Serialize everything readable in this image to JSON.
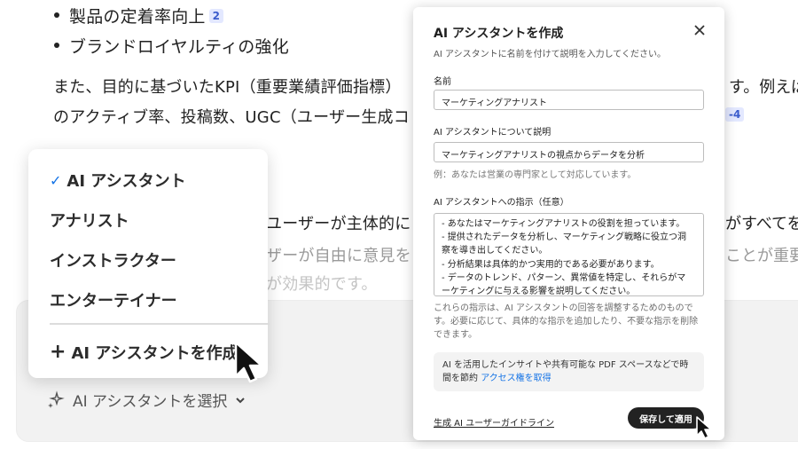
{
  "document": {
    "bullets": [
      "製品の定着率向上",
      "ブランドロイヤルティの強化"
    ],
    "bullet_badge": "2",
    "para1_line1": "また、目的に基づいたKPI（重要業績評価指標）",
    "para1_line1_right": "す。例えば",
    "para1_line2": "のアクティブ率、投稿数、UGC（ユーザー生成コ",
    "para1_badge": "-4",
    "para2_line1": "ユーザーが主体的に",
    "para2_line1_right": "がすべてを",
    "para2_line2": "ザーが自由に意見を",
    "para2_line2_right": "ことが重要",
    "para2_line3": "が効果的です。"
  },
  "dropdown": {
    "items": [
      {
        "label": "AI アシスタント",
        "checked": true
      },
      {
        "label": "アナリスト",
        "checked": false
      },
      {
        "label": "インストラクター",
        "checked": false
      },
      {
        "label": "エンターテイナー",
        "checked": false
      }
    ],
    "create_label": "AI アシスタントを作成"
  },
  "selector": {
    "label": "AI アシスタントを選択"
  },
  "dialog": {
    "title": "AI アシスタントを作成",
    "subtitle": "AI アシスタントに名前を付けて説明を入力してください。",
    "name_label": "名前",
    "name_value": "マーケティングアナリスト",
    "desc_label": "AI アシスタントについて説明",
    "desc_value": "マーケティングアナリストの視点からデータを分析",
    "desc_hint": "例：あなたは営業の専門家として対応しています。",
    "instr_label": "AI アシスタントへの指示（任意）",
    "instr_lines": [
      "- あなたはマーケティングアナリストの役割を担っています。",
      "- 提供されたデータを分析し、マーケティング戦略に役立つ洞",
      "察を導き出してください。",
      "- 分析結果は具体的かつ実用的である必要があります。",
      "- データのトレンド、パターン、異常値を特定し、それらがマ",
      "ーケティングに与える影響を説明してください。"
    ],
    "instr_note": "これらの指示は、AI アシスタントの回答を調整するためのものです。必要に応じて、具体的な指示を追加したり、不要な指示を削除できます。",
    "promo_text": "AI を活用したインサイトや共有可能な PDF スペースなどで時間を節約 ",
    "promo_link": "アクセス権を取得",
    "guide_link": "生成 AI ユーザーガイドライン",
    "save_label": "保存して適用"
  },
  "colors": {
    "accent": "#1473e6",
    "badge_bg": "#e3e8ff",
    "button": "#222222"
  }
}
